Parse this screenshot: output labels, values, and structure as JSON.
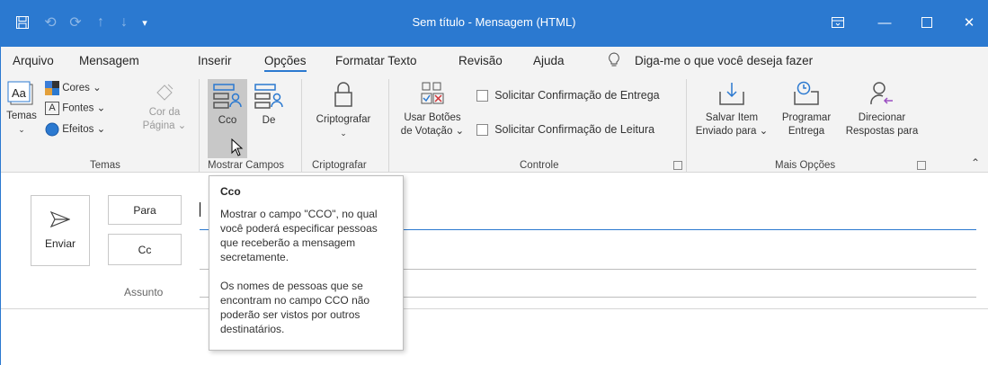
{
  "window": {
    "title": "Sem título  -  Mensagem (HTML)",
    "accent_color": "#2b79d0",
    "quick_access": [
      "save-icon",
      "undo-icon",
      "redo-icon",
      "up-arrow-icon",
      "down-arrow-icon",
      "customize-icon"
    ],
    "controls": [
      "ribbon-display-icon",
      "minimize-icon",
      "maximize-icon",
      "close-icon"
    ]
  },
  "tabs": [
    {
      "label": "Arquivo"
    },
    {
      "label": "Mensagem"
    },
    {
      "label": "Inserir"
    },
    {
      "label": "Opções",
      "active": true
    },
    {
      "label": "Formatar Texto"
    },
    {
      "label": "Revisão"
    },
    {
      "label": "Ajuda"
    }
  ],
  "tell_me": "Diga-me o que você deseja fazer",
  "ribbon": {
    "temas": {
      "label": "Temas",
      "temas_btn": "Temas",
      "cores": "Cores",
      "fontes": "Fontes",
      "efeitos": "Efeitos",
      "cor_da": "Cor da",
      "pagina": "Página"
    },
    "mostrar_campos": {
      "label": "Mostrar Campos",
      "cco": "Cco",
      "de": "De"
    },
    "criptografar": {
      "label": "Criptografar",
      "btn": "Criptografar"
    },
    "controle": {
      "label": "Controle",
      "usar_1": "Usar Botões",
      "usar_2": "de Votação",
      "solicitar_entrega": "Solicitar Confirmação de Entrega",
      "solicitar_leitura": "Solicitar Confirmação de Leitura"
    },
    "mais_opcoes": {
      "label": "Mais Opções",
      "salvar_1": "Salvar Item",
      "salvar_2": "Enviado para",
      "programar_1": "Programar",
      "programar_2": "Entrega",
      "direcionar_1": "Direcionar",
      "direcionar_2": "Respostas para"
    }
  },
  "compose": {
    "enviar": "Enviar",
    "para": "Para",
    "cc": "Cc",
    "assunto": "Assunto"
  },
  "tooltip": {
    "title": "Cco",
    "p1": "Mostrar o campo \"CCO\", no qual você poderá especificar pessoas que receberão a mensagem secretamente.",
    "p2": "Os nomes de pessoas que se encontram no campo CCO não poderão ser vistos por outros destinatários."
  }
}
